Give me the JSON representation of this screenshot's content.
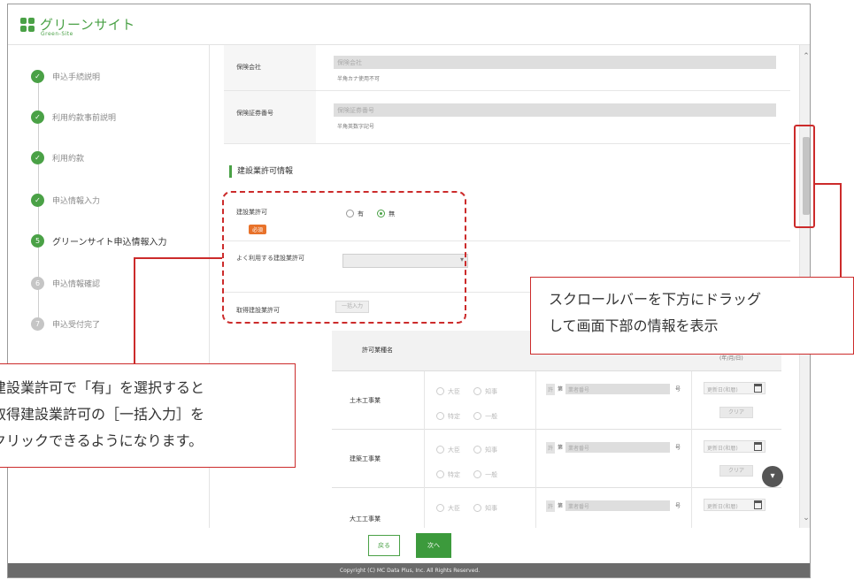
{
  "header": {
    "logo_text": "グリーンサイト",
    "logo_sub": "Green-Site"
  },
  "sidebar": {
    "steps": [
      {
        "label": "申込手続説明",
        "state": "done",
        "marker": "✓"
      },
      {
        "label": "利用約款事前説明",
        "state": "done",
        "marker": "✓"
      },
      {
        "label": "利用約款",
        "state": "done",
        "marker": "✓"
      },
      {
        "label": "申込情報入力",
        "state": "done",
        "marker": "✓"
      },
      {
        "label": "グリーンサイト申込情報入力",
        "state": "active",
        "marker": "5"
      },
      {
        "label": "申込情報確認",
        "state": "todo",
        "marker": "6"
      },
      {
        "label": "申込受付完了",
        "state": "todo",
        "marker": "7"
      }
    ]
  },
  "form": {
    "insurance_company": {
      "label": "保険会社",
      "placeholder": "保険会社",
      "hint": "半角カナ使用不可"
    },
    "policy_number": {
      "label": "保険証券番号",
      "placeholder": "保険証券番号",
      "hint": "半角英数字記号"
    },
    "section_title": "建設業許可情報",
    "permit": {
      "label": "建設業許可",
      "required": "必須",
      "opt_yes": "有",
      "opt_no": "無",
      "selected": "無"
    },
    "frequent_permit": {
      "label": "よく利用する建設業許可"
    },
    "acquired_permit": {
      "label": "取得建設業許可",
      "bulk_button": "一括入力"
    }
  },
  "table": {
    "header_name": "許可業種名",
    "header_date": "(年/月/日)",
    "opt_minister": "大臣",
    "opt_governor": "知事",
    "opt_special": "特定",
    "opt_general": "一般",
    "prefix": "許",
    "ken": "第",
    "number_placeholder": "業者番号",
    "go": "号",
    "date_placeholder": "更新日(和暦)",
    "clear": "クリア",
    "rows": [
      {
        "name": "土木工事業"
      },
      {
        "name": "建築工事業"
      },
      {
        "name": "大工工事業"
      }
    ]
  },
  "buttons": {
    "back": "戻る",
    "next": "次へ"
  },
  "footer": {
    "copyright": "Copyright (C) MC Data Plus, Inc. All Rights Reserved."
  },
  "annotations": {
    "left_lines": [
      "建設業許可で「有」を選択すると",
      "取得建設業許可の［一括入力］を",
      "クリックできるようになります。"
    ],
    "right_lines": [
      "スクロールバーを下方にドラッグ",
      "して画面下部の情報を表示"
    ]
  },
  "colors": {
    "accent": "#4aa146",
    "annotation": "#cc2b2b",
    "required": "#e8722a",
    "footer": "#6b6b6b"
  }
}
